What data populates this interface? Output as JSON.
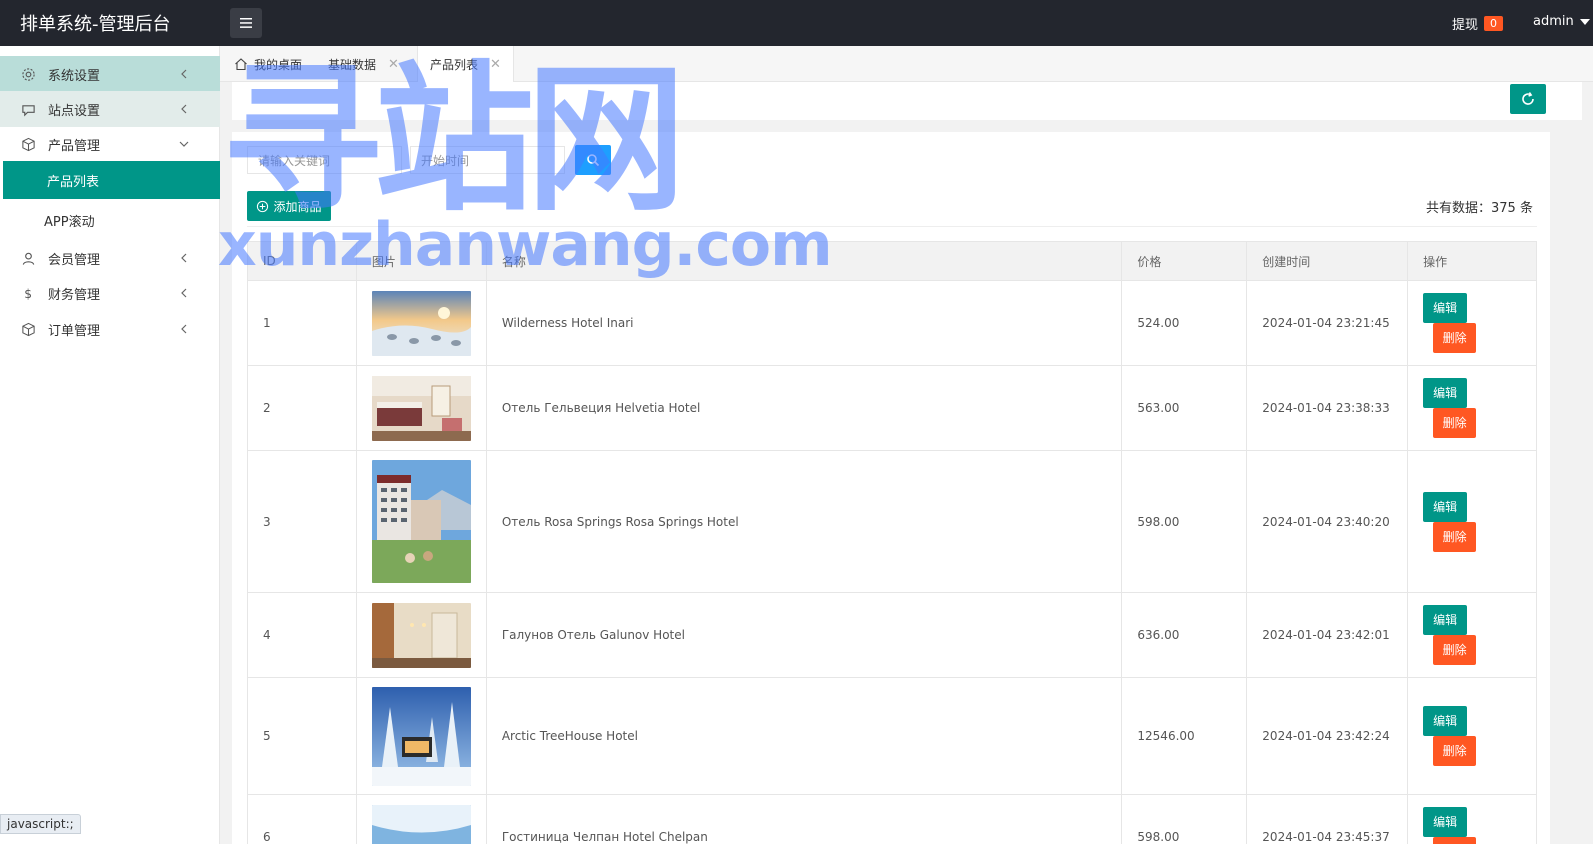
{
  "header": {
    "title": "排单系统-管理后台",
    "withdraw_label": "提现",
    "withdraw_count": "0",
    "user": "admin"
  },
  "sidebar": {
    "items": [
      {
        "label": "系统设置",
        "icon": "gear-icon"
      },
      {
        "label": "站点设置",
        "icon": "chat-icon"
      },
      {
        "label": "产品管理",
        "icon": "cube-icon"
      },
      {
        "label": "产品列表"
      },
      {
        "label": "APP滚动"
      },
      {
        "label": "会员管理",
        "icon": "user-icon"
      },
      {
        "label": "财务管理",
        "icon": "dollar-icon"
      },
      {
        "label": "订单管理",
        "icon": "cube-icon"
      }
    ]
  },
  "tabs": [
    {
      "label": "我的桌面"
    },
    {
      "label": "基础数据"
    },
    {
      "label": "产品列表"
    }
  ],
  "search": {
    "keyword_placeholder": "请输入关键词",
    "date_placeholder": "开始时间"
  },
  "toolbar": {
    "add_label": "添加商品",
    "total_label": "共有数据：375 条"
  },
  "table": {
    "columns": [
      "ID",
      "图片",
      "名称",
      "价格",
      "创建时间",
      "操作"
    ],
    "edit_label": "编辑",
    "delete_label": "删除",
    "rows": [
      {
        "id": "1",
        "name": "Wilderness Hotel Inari",
        "price": "524.00",
        "created": "2024-01-04 23:21:45",
        "image": "snow-village"
      },
      {
        "id": "2",
        "name": "Отель Гельвеция Helvetia Hotel",
        "price": "563.00",
        "created": "2024-01-04 23:38:33",
        "image": "hotel-room"
      },
      {
        "id": "3",
        "name": "Отель Rosa Springs Rosa Springs Hotel",
        "price": "598.00",
        "created": "2024-01-04 23:40:20",
        "image": "tower-hotel"
      },
      {
        "id": "4",
        "name": "Галунов Отель Galunov Hotel",
        "price": "636.00",
        "created": "2024-01-04 23:42:01",
        "image": "hallway"
      },
      {
        "id": "5",
        "name": "Arctic TreeHouse Hotel",
        "price": "12546.00",
        "created": "2024-01-04 23:42:24",
        "image": "treehouse"
      },
      {
        "id": "6",
        "name": "Гостиница Челпан Hotel Chelpan",
        "price": "598.00",
        "created": "2024-01-04 23:45:37",
        "image": "sky-room"
      }
    ]
  },
  "watermark": {
    "big": "寻站网",
    "small": "xunzhanwang.com"
  },
  "status_bar": "javascript:;"
}
